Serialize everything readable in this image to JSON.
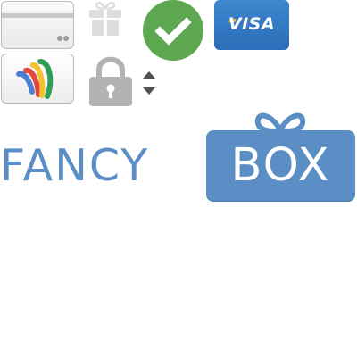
{
  "icons": {
    "generic_card": "credit-card-icon",
    "gift": "gift-icon",
    "check": "checkmark-icon",
    "visa_card": "visa-card-icon",
    "wallet_card": "google-wallet-icon",
    "lock": "lock-icon",
    "sort": "sort-arrows-icon",
    "bow": "ribbon-bow-icon"
  },
  "visa": {
    "label": "VISA"
  },
  "logo": {
    "word_left": "FANCY",
    "word_right": "BOX"
  },
  "colors": {
    "brand_blue": "#5b8ec4",
    "check_green": "#5ca74f",
    "visa_blue": "#2a6db8",
    "icon_gray": "#b3b3b3"
  }
}
